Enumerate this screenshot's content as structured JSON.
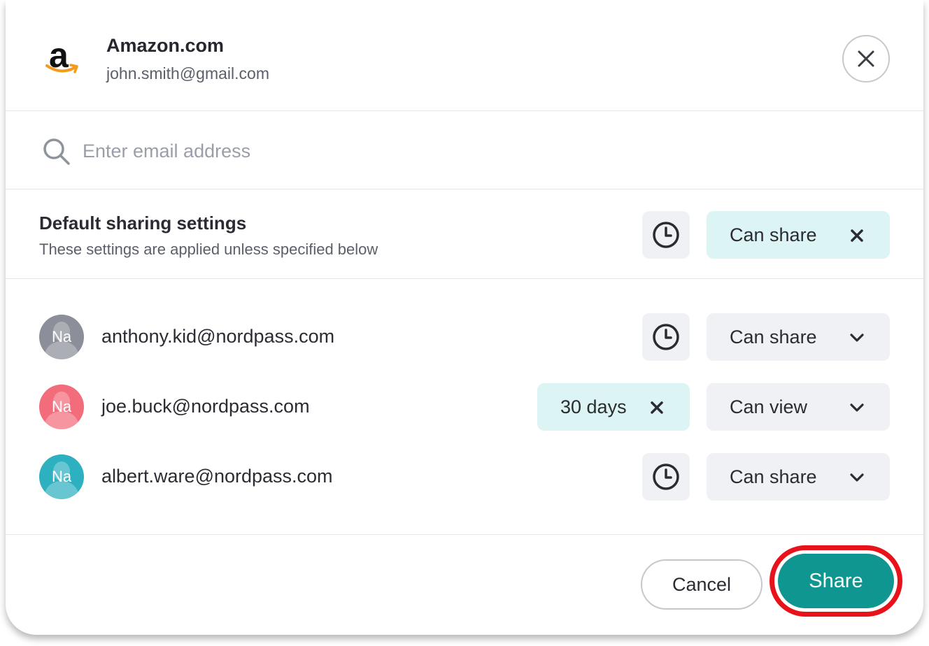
{
  "header": {
    "site_name": "Amazon.com",
    "account": "john.smith@gmail.com",
    "logo_icon": "amazon-logo",
    "close_icon": "close-icon"
  },
  "search": {
    "placeholder": "Enter email address",
    "value": "",
    "icon": "search-icon"
  },
  "default_settings": {
    "title": "Default sharing settings",
    "subtitle": "These settings are applied unless specified below",
    "permission": "Can share",
    "permission_icon": "clear-x-icon",
    "expiry_icon": "clock-icon"
  },
  "users": [
    {
      "initials": "Na",
      "email": "anthony.kid@nordpass.com",
      "avatar_color": "#8c8f99",
      "expiry": null,
      "permission": "Can share"
    },
    {
      "initials": "Na",
      "email": "joe.buck@nordpass.com",
      "avatar_color": "#f36c7c",
      "expiry": "30 days",
      "permission": "Can view"
    },
    {
      "initials": "Na",
      "email": "albert.ware@nordpass.com",
      "avatar_color": "#2db0bf",
      "expiry": null,
      "permission": "Can share"
    }
  ],
  "footer": {
    "cancel_label": "Cancel",
    "share_label": "Share"
  },
  "colors": {
    "accent_teal": "#0f9690",
    "chip_teal_bg": "#dcf4f3",
    "highlight_ring": "#e8121a",
    "neutral_chip_bg": "#f0f1f4"
  }
}
